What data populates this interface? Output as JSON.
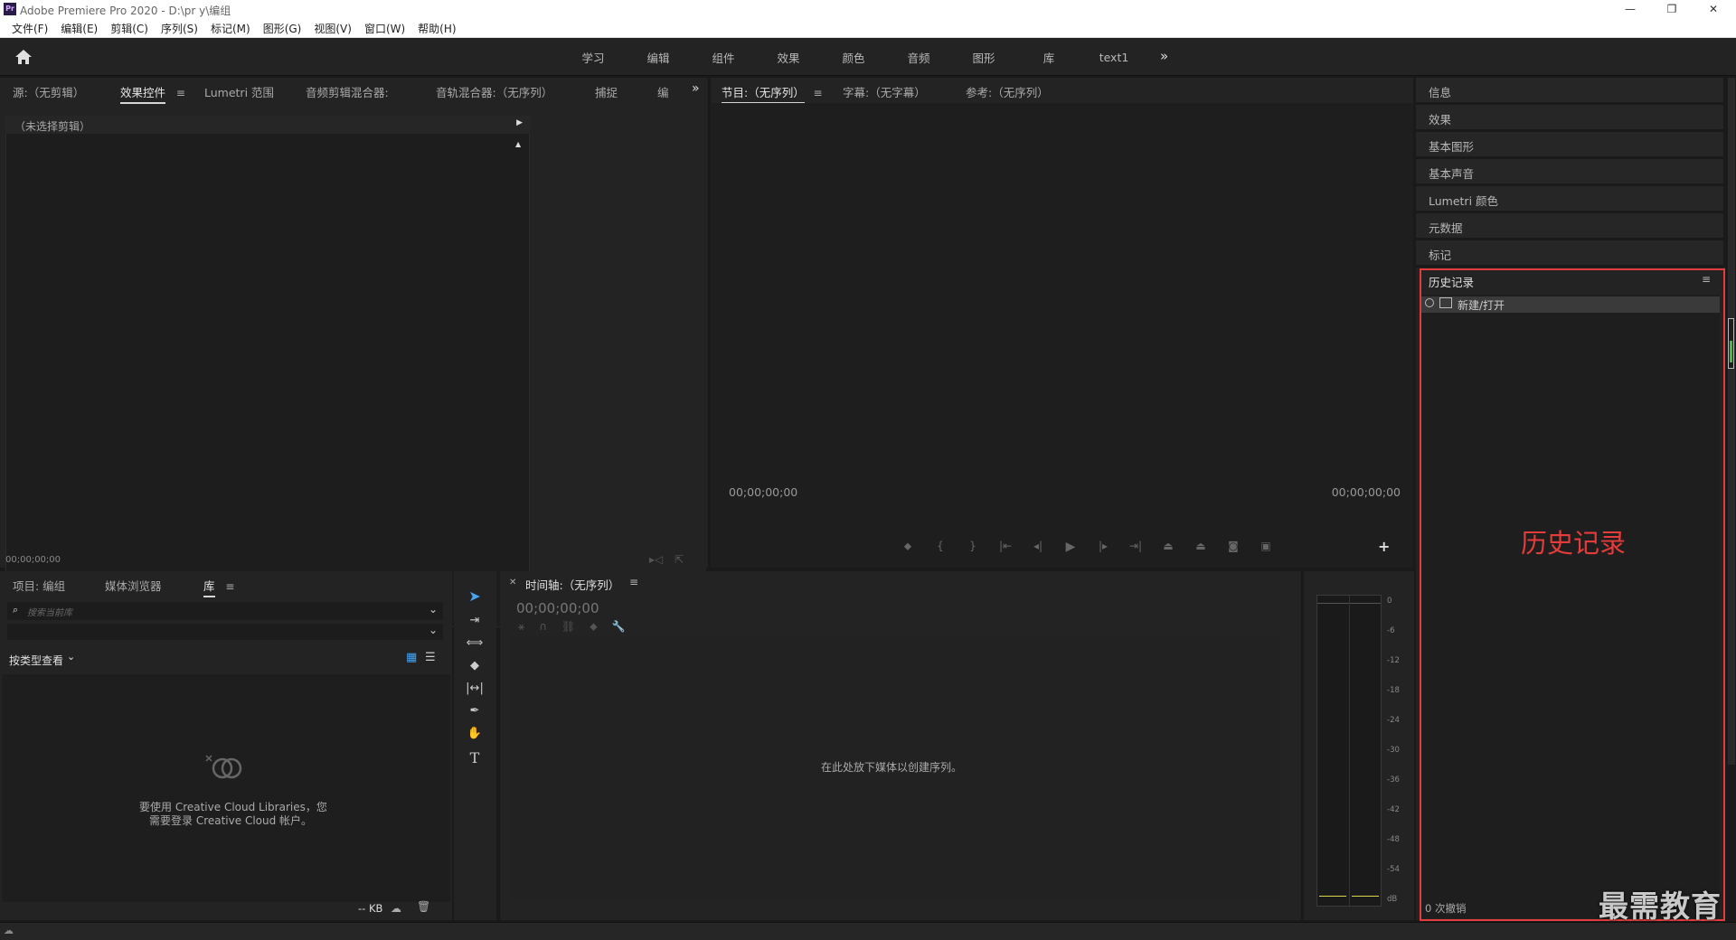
{
  "titlebar": {
    "app_icon": "Pr",
    "title": "Adobe Premiere Pro 2020 - D:\\pr y\\编组",
    "minimize": "—",
    "restore": "❐",
    "close": "✕"
  },
  "menubar": {
    "items": [
      "文件(F)",
      "编辑(E)",
      "剪辑(C)",
      "序列(S)",
      "标记(M)",
      "图形(G)",
      "视图(V)",
      "窗口(W)",
      "帮助(H)"
    ]
  },
  "workspaces": {
    "tabs": [
      "学习",
      "编辑",
      "组件",
      "效果",
      "颜色",
      "音频",
      "图形",
      "库",
      "text1"
    ],
    "more": "»"
  },
  "source_panel": {
    "tabs": [
      "源:（无剪辑）",
      "效果控件",
      "Lumetri 范围",
      "音频剪辑混合器:",
      "音轨混合器:（无序列）",
      "捕捉",
      "编"
    ],
    "active_tab_index": 1,
    "no_clip_label": "（未选择剪辑）",
    "timecode": "00;00;00;00",
    "more": "»"
  },
  "program_panel": {
    "tabs": [
      "节目:（无序列）",
      "字幕:（无字幕）",
      "参考:（无序列）"
    ],
    "timecode_left": "00;00;00;00",
    "timecode_right": "00;00;00;00",
    "add": "+"
  },
  "right_panels": {
    "items": [
      "信息",
      "效果",
      "基本图形",
      "基本声音",
      "Lumetri 颜色",
      "元数据",
      "标记"
    ]
  },
  "history_panel": {
    "title": "历史记录",
    "entry": "新建/打开",
    "undo_count": "0 次撤销",
    "annotation": "历史记录",
    "annotation_color": "#e43b3b"
  },
  "library_panel": {
    "tabs": [
      "项目: 编组",
      "媒体浏览器",
      "库"
    ],
    "active_tab_index": 2,
    "search_placeholder": "搜索当前库",
    "view_by": "按类型查看",
    "message_line1": "要使用 Creative Cloud Libraries，您",
    "message_line2": "需要登录 Creative Cloud 帐户。",
    "size": "-- KB"
  },
  "timeline_panel": {
    "title": "时间轴:（无序列）",
    "timecode": "00;00;00;00",
    "drop_hint": "在此处放下媒体以创建序列。"
  },
  "meters": {
    "scale": [
      "0",
      "-6",
      "-12",
      "-18",
      "-24",
      "-30",
      "-36",
      "-42",
      "-48",
      "-54",
      "dB"
    ]
  },
  "watermark": "最需教育"
}
